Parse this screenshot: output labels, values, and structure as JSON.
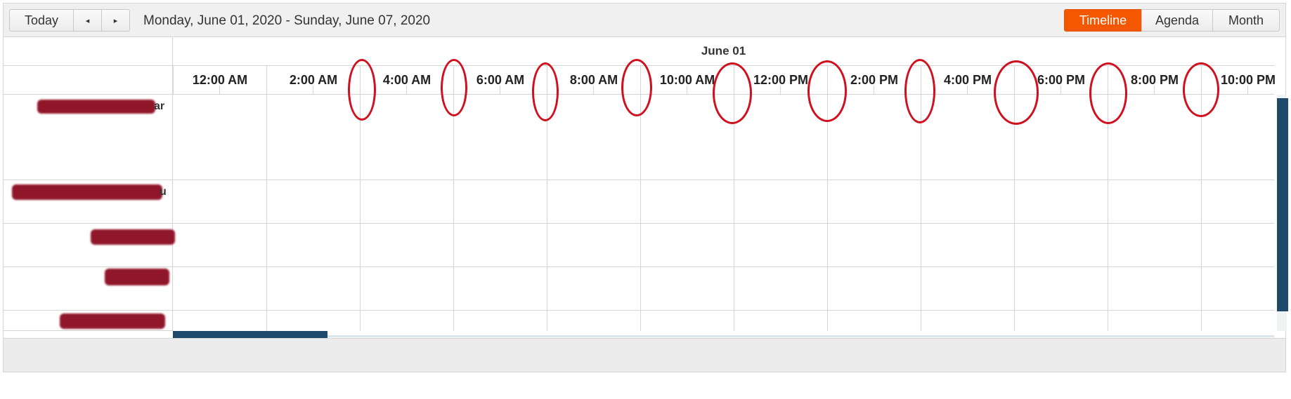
{
  "toolbar": {
    "today_label": "Today",
    "prev_icon": "◂",
    "next_icon": "▸",
    "date_range": "Monday, June 01, 2020 - Sunday, June 07, 2020",
    "views": [
      "Timeline",
      "Agenda",
      "Month"
    ],
    "active_view": "Timeline",
    "accent_color": "#f35800"
  },
  "header": {
    "date": "June 01",
    "times": [
      "12:00 AM",
      "2:00 AM",
      "4:00 AM",
      "6:00 AM",
      "8:00 AM",
      "10:00 AM",
      "12:00 PM",
      "2:00 PM",
      "4:00 PM",
      "6:00 PM",
      "8:00 PM",
      "10:00 PM"
    ]
  },
  "rows": [
    {
      "visible_suffix": "ar"
    },
    {
      "visible_suffix": "u"
    },
    {
      "visible_suffix": ""
    },
    {
      "visible_suffix": ""
    },
    {
      "visible_suffix": ""
    }
  ],
  "annotation_color": "#d0101e"
}
